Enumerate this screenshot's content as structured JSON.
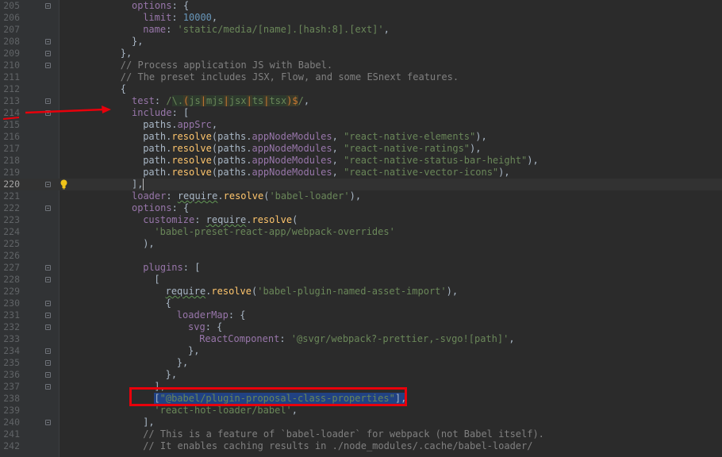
{
  "editor": {
    "first_line": 205,
    "current_line": 220,
    "lines": [
      {
        "n": "205",
        "indent": 5,
        "fold": true,
        "tokens": [
          [
            "prop",
            "options"
          ],
          [
            "plain",
            ": {"
          ]
        ]
      },
      {
        "n": "206",
        "indent": 6,
        "tokens": [
          [
            "prop",
            "limit"
          ],
          [
            "plain",
            ": "
          ],
          [
            "num",
            "10000"
          ],
          [
            "plain",
            ","
          ]
        ]
      },
      {
        "n": "207",
        "indent": 6,
        "tokens": [
          [
            "prop",
            "name"
          ],
          [
            "plain",
            ": "
          ],
          [
            "str",
            "'static/media/[name].[hash:8].[ext]'"
          ],
          [
            "plain",
            ","
          ]
        ]
      },
      {
        "n": "208",
        "indent": 5,
        "fold": true,
        "tokens": [
          [
            "plain",
            "},"
          ]
        ]
      },
      {
        "n": "209",
        "indent": 4,
        "fold": true,
        "tokens": [
          [
            "plain",
            "},"
          ]
        ]
      },
      {
        "n": "210",
        "indent": 4,
        "fold": true,
        "tokens": [
          [
            "com",
            "// Process application JS with Babel."
          ]
        ]
      },
      {
        "n": "211",
        "indent": 4,
        "tokens": [
          [
            "com",
            "// The preset includes JSX, Flow, and some ESnext features."
          ]
        ]
      },
      {
        "n": "212",
        "indent": 4,
        "tokens": [
          [
            "plain",
            "{"
          ]
        ]
      },
      {
        "n": "213",
        "indent": 5,
        "fold": true,
        "tokens": [
          [
            "prop",
            "test"
          ],
          [
            "plain",
            ": "
          ],
          [
            "str",
            "/"
          ],
          [
            "rx",
            "\\."
          ],
          [
            "rxop",
            "("
          ],
          [
            "rx",
            "js"
          ],
          [
            "rxop",
            "|"
          ],
          [
            "rx",
            "mjs"
          ],
          [
            "rxop",
            "|"
          ],
          [
            "rx",
            "jsx"
          ],
          [
            "rxop",
            "|"
          ],
          [
            "rx",
            "ts"
          ],
          [
            "rxop",
            "|"
          ],
          [
            "rx",
            "tsx"
          ],
          [
            "rxop",
            ")"
          ],
          [
            "rxop",
            "$"
          ],
          [
            "str",
            "/"
          ],
          [
            "plain",
            ","
          ]
        ]
      },
      {
        "n": "214",
        "indent": 5,
        "fold": true,
        "tokens": [
          [
            "prop",
            "include"
          ],
          [
            "plain",
            ": ["
          ]
        ]
      },
      {
        "n": "215",
        "indent": 6,
        "tokens": [
          [
            "plain",
            "paths."
          ],
          [
            "prop",
            "appSrc"
          ],
          [
            "plain",
            ","
          ]
        ]
      },
      {
        "n": "216",
        "indent": 6,
        "tokens": [
          [
            "plain",
            "path."
          ],
          [
            "fn",
            "resolve"
          ],
          [
            "plain",
            "(paths."
          ],
          [
            "prop",
            "appNodeModules"
          ],
          [
            "plain",
            ", "
          ],
          [
            "str",
            "\"react-native-elements\""
          ],
          [
            "plain",
            "),"
          ]
        ]
      },
      {
        "n": "217",
        "indent": 6,
        "tokens": [
          [
            "plain",
            "path."
          ],
          [
            "fn",
            "resolve"
          ],
          [
            "plain",
            "(paths."
          ],
          [
            "prop",
            "appNodeModules"
          ],
          [
            "plain",
            ", "
          ],
          [
            "str",
            "\"react-native-ratings\""
          ],
          [
            "plain",
            "),"
          ]
        ]
      },
      {
        "n": "218",
        "indent": 6,
        "tokens": [
          [
            "plain",
            "path."
          ],
          [
            "fn",
            "resolve"
          ],
          [
            "plain",
            "(paths."
          ],
          [
            "prop",
            "appNodeModules"
          ],
          [
            "plain",
            ", "
          ],
          [
            "str",
            "\"react-native-status-bar-height\""
          ],
          [
            "plain",
            "),"
          ]
        ]
      },
      {
        "n": "219",
        "indent": 6,
        "tokens": [
          [
            "plain",
            "path."
          ],
          [
            "fn",
            "resolve"
          ],
          [
            "plain",
            "(paths."
          ],
          [
            "prop",
            "appNodeModules"
          ],
          [
            "plain",
            ", "
          ],
          [
            "str",
            "\"react-native-vector-icons\""
          ],
          [
            "plain",
            "),"
          ]
        ]
      },
      {
        "n": "220",
        "indent": 5,
        "fold": true,
        "current": true,
        "bulb": true,
        "tokens": [
          [
            "plain",
            "],"
          ]
        ]
      },
      {
        "n": "221",
        "indent": 5,
        "tokens": [
          [
            "prop",
            "loader"
          ],
          [
            "plain",
            ": "
          ],
          [
            "squig",
            "require"
          ],
          [
            "plain",
            "."
          ],
          [
            "fn",
            "resolve"
          ],
          [
            "plain",
            "("
          ],
          [
            "str",
            "'babel-loader'"
          ],
          [
            "plain",
            "),"
          ]
        ]
      },
      {
        "n": "222",
        "indent": 5,
        "fold": true,
        "tokens": [
          [
            "prop",
            "options"
          ],
          [
            "plain",
            ": {"
          ]
        ]
      },
      {
        "n": "223",
        "indent": 6,
        "tokens": [
          [
            "prop",
            "customize"
          ],
          [
            "plain",
            ": "
          ],
          [
            "squig",
            "require"
          ],
          [
            "plain",
            "."
          ],
          [
            "fn",
            "resolve"
          ],
          [
            "plain",
            "("
          ]
        ]
      },
      {
        "n": "224",
        "indent": 7,
        "tokens": [
          [
            "str",
            "'babel-preset-react-app/webpack-overrides'"
          ]
        ]
      },
      {
        "n": "225",
        "indent": 6,
        "tokens": [
          [
            "plain",
            "),"
          ]
        ]
      },
      {
        "n": "226",
        "indent": 0,
        "tokens": []
      },
      {
        "n": "227",
        "indent": 6,
        "fold": true,
        "tokens": [
          [
            "prop",
            "plugins"
          ],
          [
            "plain",
            ": ["
          ]
        ]
      },
      {
        "n": "228",
        "indent": 7,
        "fold": true,
        "tokens": [
          [
            "plain",
            "["
          ]
        ]
      },
      {
        "n": "229",
        "indent": 8,
        "tokens": [
          [
            "squig",
            "require"
          ],
          [
            "plain",
            "."
          ],
          [
            "fn",
            "resolve"
          ],
          [
            "plain",
            "("
          ],
          [
            "str",
            "'babel-plugin-named-asset-import'"
          ],
          [
            "plain",
            "),"
          ]
        ]
      },
      {
        "n": "230",
        "indent": 8,
        "fold": true,
        "tokens": [
          [
            "plain",
            "{"
          ]
        ]
      },
      {
        "n": "231",
        "indent": 9,
        "fold": true,
        "tokens": [
          [
            "prop",
            "loaderMap"
          ],
          [
            "plain",
            ": {"
          ]
        ]
      },
      {
        "n": "232",
        "indent": 10,
        "fold": true,
        "tokens": [
          [
            "prop",
            "svg"
          ],
          [
            "plain",
            ": {"
          ]
        ]
      },
      {
        "n": "233",
        "indent": 11,
        "tokens": [
          [
            "prop",
            "ReactComponent"
          ],
          [
            "plain",
            ": "
          ],
          [
            "str",
            "'@svgr/webpack?-prettier,-svgo![path]'"
          ],
          [
            "plain",
            ","
          ]
        ]
      },
      {
        "n": "234",
        "indent": 10,
        "fold": true,
        "tokens": [
          [
            "plain",
            "},"
          ]
        ]
      },
      {
        "n": "235",
        "indent": 9,
        "fold": true,
        "tokens": [
          [
            "plain",
            "},"
          ]
        ]
      },
      {
        "n": "236",
        "indent": 8,
        "fold": true,
        "tokens": [
          [
            "plain",
            "},"
          ]
        ]
      },
      {
        "n": "237",
        "indent": 7,
        "fold": true,
        "tokens": [
          [
            "plain",
            "],"
          ]
        ]
      },
      {
        "n": "238",
        "indent": 7,
        "sel": true,
        "tokens": [
          [
            "plain",
            "["
          ],
          [
            "str",
            "\"@babel/plugin-proposal-class-properties\""
          ],
          [
            "plain",
            "],"
          ]
        ]
      },
      {
        "n": "239",
        "indent": 7,
        "tokens": [
          [
            "str",
            "'react-hot-loader/babel'"
          ],
          [
            "plain",
            ","
          ]
        ]
      },
      {
        "n": "240",
        "indent": 6,
        "fold": true,
        "tokens": [
          [
            "plain",
            "],"
          ]
        ]
      },
      {
        "n": "241",
        "indent": 6,
        "tokens": [
          [
            "com",
            "// This is a feature of `babel-loader` for webpack (not Babel itself)."
          ]
        ]
      },
      {
        "n": "242",
        "indent": 6,
        "tokens": [
          [
            "com",
            "// It enables caching results in ./node_modules/.cache/babel-loader/"
          ]
        ]
      }
    ]
  },
  "colors": {
    "background": "#2b2b2b",
    "gutter": "#313335",
    "annotation_red": "#e8000b",
    "selection": "#214283"
  },
  "icons": [
    "fold-marker-icon",
    "lightbulb-icon",
    "red-arrow-annotation"
  ]
}
